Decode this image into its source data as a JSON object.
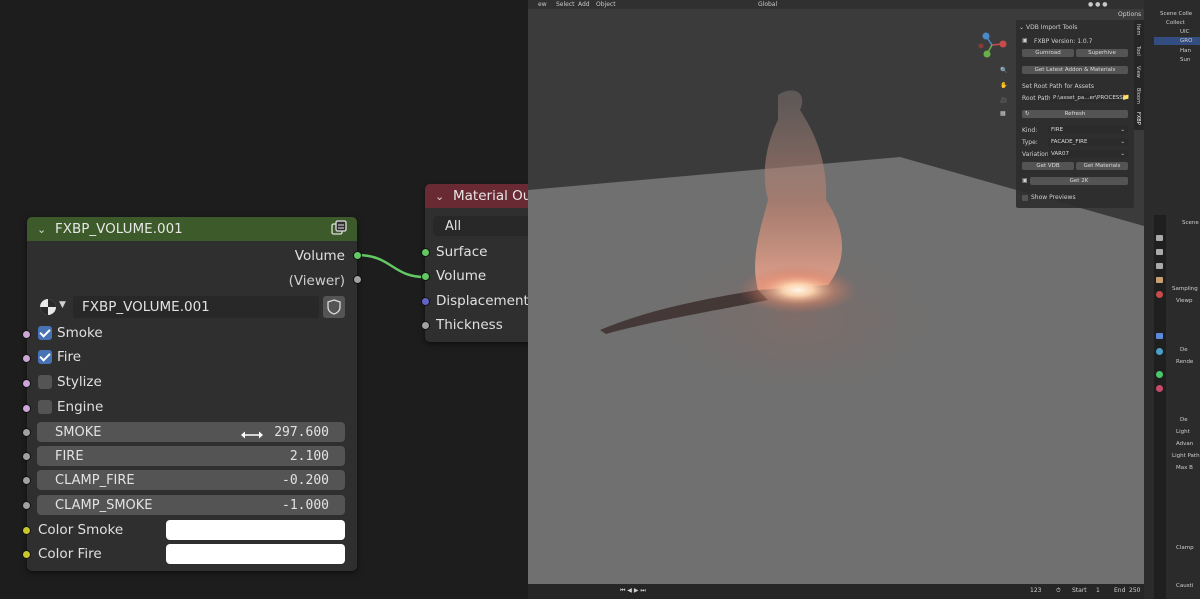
{
  "volume_node": {
    "title": "FXBP_VOLUME.001",
    "outputs": [
      "Volume",
      "(Viewer)"
    ],
    "datablock_name": "FXBP_VOLUME.001",
    "checkboxes": [
      {
        "label": "Smoke",
        "checked": true
      },
      {
        "label": "Fire",
        "checked": true
      },
      {
        "label": "Stylize",
        "checked": false
      },
      {
        "label": "Engine",
        "checked": false
      }
    ],
    "fields": [
      {
        "label": "SMOKE",
        "value": "297.600"
      },
      {
        "label": "FIRE",
        "value": "2.100"
      },
      {
        "label": "CLAMP_FIRE",
        "value": "-0.200"
      },
      {
        "label": "CLAMP_SMOKE",
        "value": "-1.000"
      }
    ],
    "colors": [
      {
        "label": "Color Smoke",
        "value": "#ffffff"
      },
      {
        "label": "Color Fire",
        "value": "#ffffff"
      }
    ],
    "header_color": "#3c5a2a"
  },
  "output_node": {
    "title": "Material Outp",
    "target": "All",
    "inputs": [
      "Surface",
      "Volume",
      "Displacement",
      "Thickness"
    ],
    "header_color": "#6a2a33"
  },
  "viewport": {
    "menu": [
      "ew",
      "Select",
      "Add",
      "Object"
    ],
    "orientation": "Global",
    "options_label": "Options",
    "side_tabs": [
      "Item",
      "Tool",
      "View",
      "Bloom",
      "FXBP"
    ],
    "npanel": {
      "title": "VDB Import Tools",
      "version": "FXBP Version: 1.0.7",
      "gumroad": "Gumroad",
      "superhive": "Superhive",
      "latest": "Get Latest Addon & Materials",
      "root_heading": "Set Root Path for Assets",
      "root_label": "Root Path:",
      "root_value": "P:\\asset_pa...er\\PROCESS\\",
      "refresh": "Refresh",
      "kind_label": "Kind:",
      "kind_value": "FIRE",
      "type_label": "Type:",
      "type_value": "FACADE_FIRE",
      "variation_label": "Variation:",
      "variation_value": "VAR07",
      "get_vdb": "Get VDB",
      "get_materials": "Get Materials",
      "get_2k": "Get 2K",
      "show_previews": "Show Previews"
    },
    "timeline": {
      "frame": "123",
      "start_label": "Start",
      "start": "1",
      "end_label": "End",
      "end": "250"
    }
  },
  "outliner": {
    "items": [
      "Scene Colle",
      "Collect",
      "UIC",
      "GRO",
      "Han",
      "Sun"
    ]
  },
  "properties": {
    "scene": "Scene",
    "items": [
      "Sampling",
      "Viewp",
      "De",
      "Rende",
      "De",
      "Light",
      "Advan",
      "Light Path",
      "Max B",
      "Clamp",
      "Causti"
    ]
  }
}
